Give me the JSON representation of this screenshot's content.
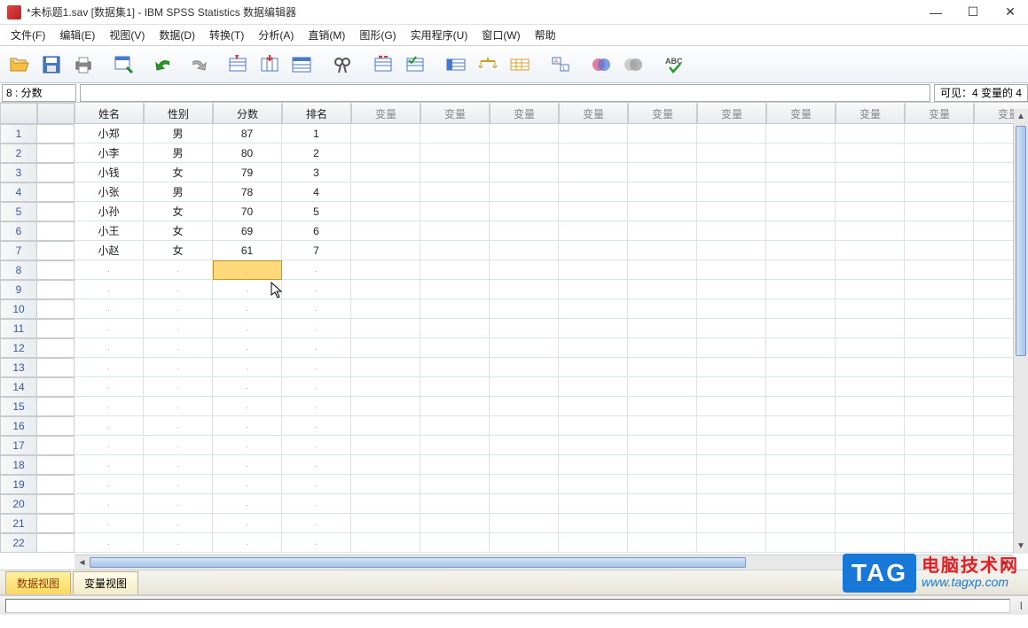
{
  "window": {
    "title": "*未标题1.sav [数据集1] - IBM SPSS Statistics 数据编辑器"
  },
  "menu": {
    "file": "文件(F)",
    "edit": "编辑(E)",
    "view": "视图(V)",
    "data": "数据(D)",
    "transform": "转换(T)",
    "analyze": "分析(A)",
    "direct": "直销(M)",
    "graphs": "图形(G)",
    "utilities": "实用程序(U)",
    "window": "窗口(W)",
    "help": "帮助"
  },
  "cellref": {
    "position": "8 : 分数",
    "visible": "可见：4 变量的 4"
  },
  "columns": {
    "defined": [
      "姓名",
      "性别",
      "分数",
      "排名"
    ],
    "empty_label": "变量"
  },
  "rows": [
    {
      "num": "1",
      "name": "小郑",
      "gender": "男",
      "score": "87",
      "rank": "1"
    },
    {
      "num": "2",
      "name": "小李",
      "gender": "男",
      "score": "80",
      "rank": "2"
    },
    {
      "num": "3",
      "name": "小钱",
      "gender": "女",
      "score": "79",
      "rank": "3"
    },
    {
      "num": "4",
      "name": "小张",
      "gender": "男",
      "score": "78",
      "rank": "4"
    },
    {
      "num": "5",
      "name": "小孙",
      "gender": "女",
      "score": "70",
      "rank": "5"
    },
    {
      "num": "6",
      "name": "小王",
      "gender": "女",
      "score": "69",
      "rank": "6"
    },
    {
      "num": "7",
      "name": "小赵",
      "gender": "女",
      "score": "61",
      "rank": "7"
    }
  ],
  "empty_rows": [
    "8",
    "9",
    "10",
    "11",
    "12",
    "13",
    "14",
    "15",
    "16",
    "17",
    "18",
    "19",
    "20",
    "21",
    "22"
  ],
  "selected": {
    "row": "8",
    "col": "score"
  },
  "tabs": {
    "data_view": "数据视图",
    "var_view": "变量视图"
  },
  "watermark": {
    "tag": "TAG",
    "cn": "电脑技术网",
    "url": "www.tagxp.com"
  }
}
